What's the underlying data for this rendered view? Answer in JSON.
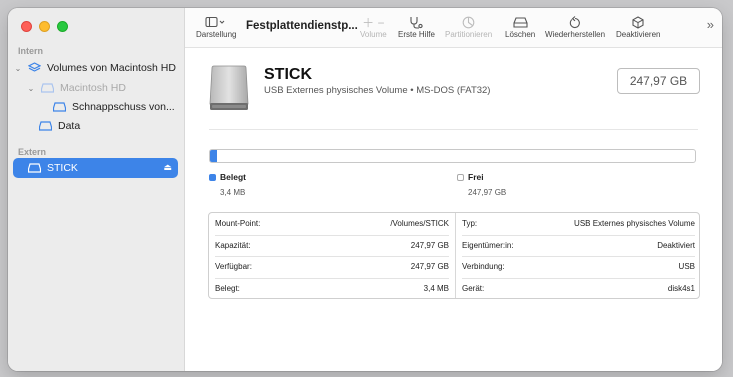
{
  "sidebar": {
    "section_internal": "Intern",
    "section_external": "Extern",
    "items": [
      {
        "label": "Volumes von Macintosh HD"
      },
      {
        "label": "Macintosh HD"
      },
      {
        "label": "Schnappschuss von..."
      },
      {
        "label": "Data"
      },
      {
        "label": "STICK"
      }
    ]
  },
  "toolbar": {
    "view_label": "Darstellung",
    "title": "Festplattendienstp...",
    "volume_label": "Volume",
    "first_aid_label": "Erste Hilfe",
    "partition_label": "Partitionieren",
    "erase_label": "Löschen",
    "restore_label": "Wiederherstellen",
    "unmount_label": "Deaktivieren",
    "more_symbol": "»"
  },
  "volume": {
    "name": "STICK",
    "subtitle": "USB Externes physisches Volume • MS-DOS (FAT32)",
    "size": "247,97 GB",
    "used_fraction": 0.014
  },
  "legend": {
    "used_label": "Belegt",
    "used_value": "3,4 MB",
    "free_label": "Frei",
    "free_value": "247,97 GB"
  },
  "info_left": [
    {
      "key": "Mount-Point:",
      "value": "/Volumes/STICK"
    },
    {
      "key": "Kapazität:",
      "value": "247,97 GB"
    },
    {
      "key": "Verfügbar:",
      "value": "247,97 GB"
    },
    {
      "key": "Belegt:",
      "value": "3,4 MB"
    }
  ],
  "info_right": [
    {
      "key": "Typ:",
      "value": "USB Externes physisches Volume"
    },
    {
      "key": "Eigentümer:in:",
      "value": "Deaktiviert"
    },
    {
      "key": "Verbindung:",
      "value": "USB"
    },
    {
      "key": "Gerät:",
      "value": "disk4s1"
    }
  ],
  "colors": {
    "accent": "#3d84e8",
    "sidebar_bg": "#ececec"
  }
}
